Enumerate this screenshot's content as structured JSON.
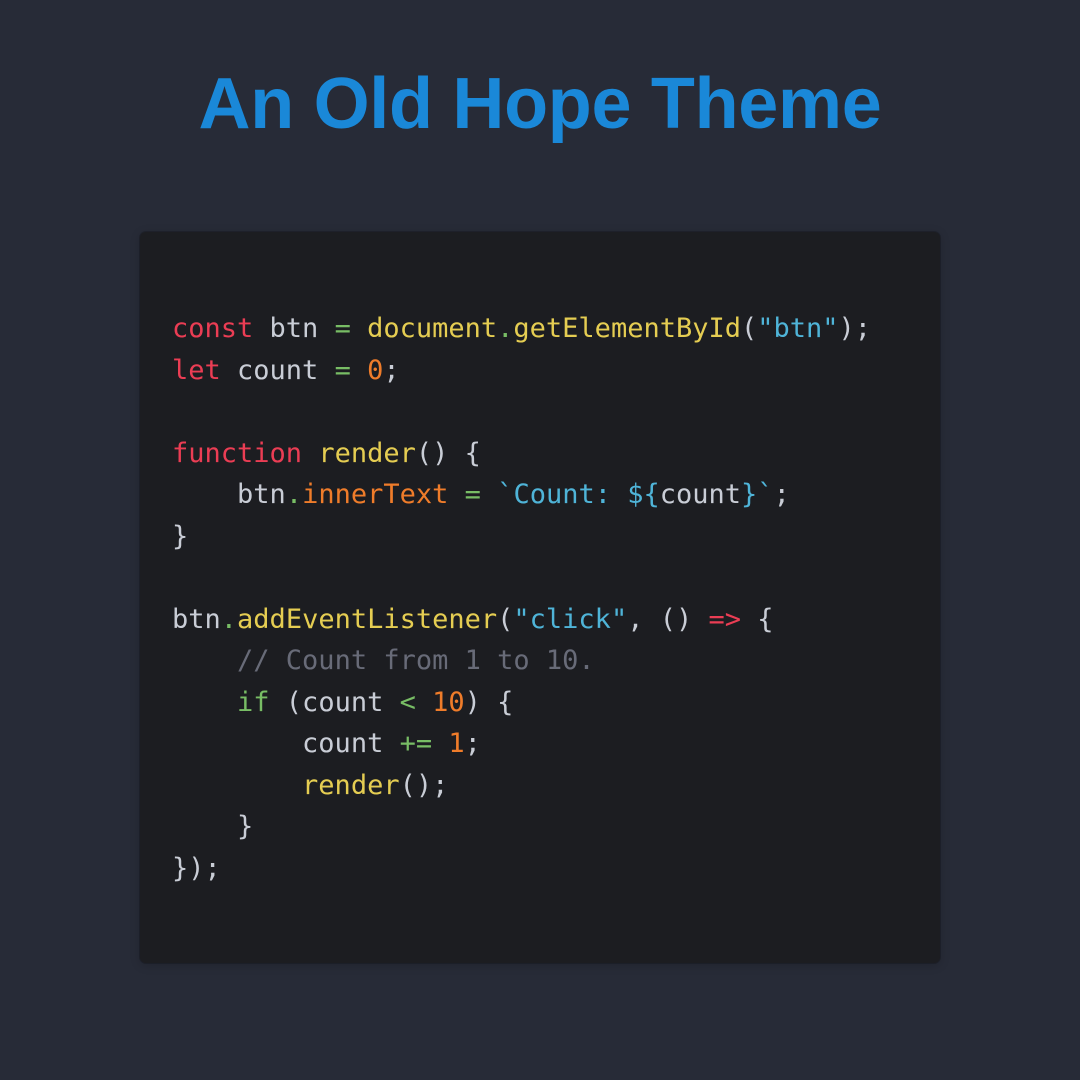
{
  "page": {
    "title": "An Old Hope Theme"
  },
  "colors": {
    "background": "#272b37",
    "title": "#1a88d8",
    "code_background": "#1c1d21",
    "keyword": "#eb3d54",
    "function": "#e5cd52",
    "property": "#ef7c2a",
    "string": "#4fb4d8",
    "number": "#ef7c2a",
    "operator": "#78bd65",
    "comment": "#686b78",
    "plain": "#c9cdd6"
  },
  "code": {
    "line_1": {
      "const": "const",
      "btn": " btn ",
      "eq": "=",
      "document": " document",
      "dot": ".",
      "getElementById": "getElementById",
      "open": "(",
      "str": "\"btn\"",
      "close": ");"
    },
    "line_2": {
      "let": "let",
      "count": " count ",
      "eq": "=",
      "space": " ",
      "zero": "0",
      "semi": ";"
    },
    "line_4": {
      "function": "function",
      "space": " ",
      "render": "render",
      "rest": "() {"
    },
    "line_5": {
      "indent": "    ",
      "btn": "btn",
      "dot": ".",
      "innerText": "innerText",
      "eq": " = ",
      "tick_open": "`",
      "template": "Count: ",
      "interp_open": "${",
      "count": "count",
      "interp_close": "}",
      "tick_close": "`",
      "semi": ";"
    },
    "line_6": {
      "brace": "}"
    },
    "line_8": {
      "btn": "btn",
      "dot": ".",
      "method": "addEventListener",
      "open": "(",
      "str": "\"click\"",
      "middle": ", () ",
      "arrow": "=>",
      "brace": " {"
    },
    "line_9": {
      "indent": "    ",
      "comment": "// Count from 1 to 10."
    },
    "line_10": {
      "indent": "    ",
      "if": "if",
      "open": " (count ",
      "lt": "<",
      "space": " ",
      "ten": "10",
      "close": ") {"
    },
    "line_11": {
      "indent": "        ",
      "count": "count ",
      "op": "+=",
      "space": " ",
      "one": "1",
      "semi": ";"
    },
    "line_12": {
      "indent": "        ",
      "render": "render",
      "rest": "();"
    },
    "line_13": {
      "indent": "    ",
      "brace": "}"
    },
    "line_14": {
      "end": "});"
    }
  }
}
